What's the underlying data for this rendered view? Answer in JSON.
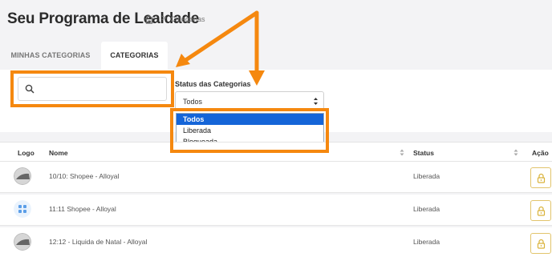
{
  "header": {
    "title": "Seu Programa de Lealdade",
    "breadcrumb_separator": ">",
    "breadcrumb_current": "Categorias"
  },
  "tabs": [
    {
      "label": "MINHAS CATEGORIAS",
      "active": false
    },
    {
      "label": "CATEGORIAS",
      "active": true
    }
  ],
  "filters": {
    "search_placeholder": "",
    "status_label": "Status das Categorias",
    "status_selected": "Todos",
    "status_options": [
      "Todos",
      "Liberada",
      "Bloqueada"
    ]
  },
  "table": {
    "columns": [
      "Logo",
      "Nome",
      "Status",
      "Ação"
    ],
    "rows": [
      {
        "logo": "circle-photo-logo",
        "name": "10/10: Shopee - Alloyal",
        "status": "Liberada",
        "action": "lock-icon"
      },
      {
        "logo": "grid-logo",
        "name": "11:11 Shopee - Alloyal",
        "status": "Liberada",
        "action": "lock-icon"
      },
      {
        "logo": "circle-photo-logo",
        "name": "12:12 - Liquida de Natal - Alloyal",
        "status": "Liberada",
        "action": "lock-icon"
      }
    ]
  },
  "colors": {
    "highlight": "#f5880f",
    "selected_option": "#1565d8",
    "lock_border": "#e2c46c",
    "grid_logo": "#5b9ee8"
  }
}
